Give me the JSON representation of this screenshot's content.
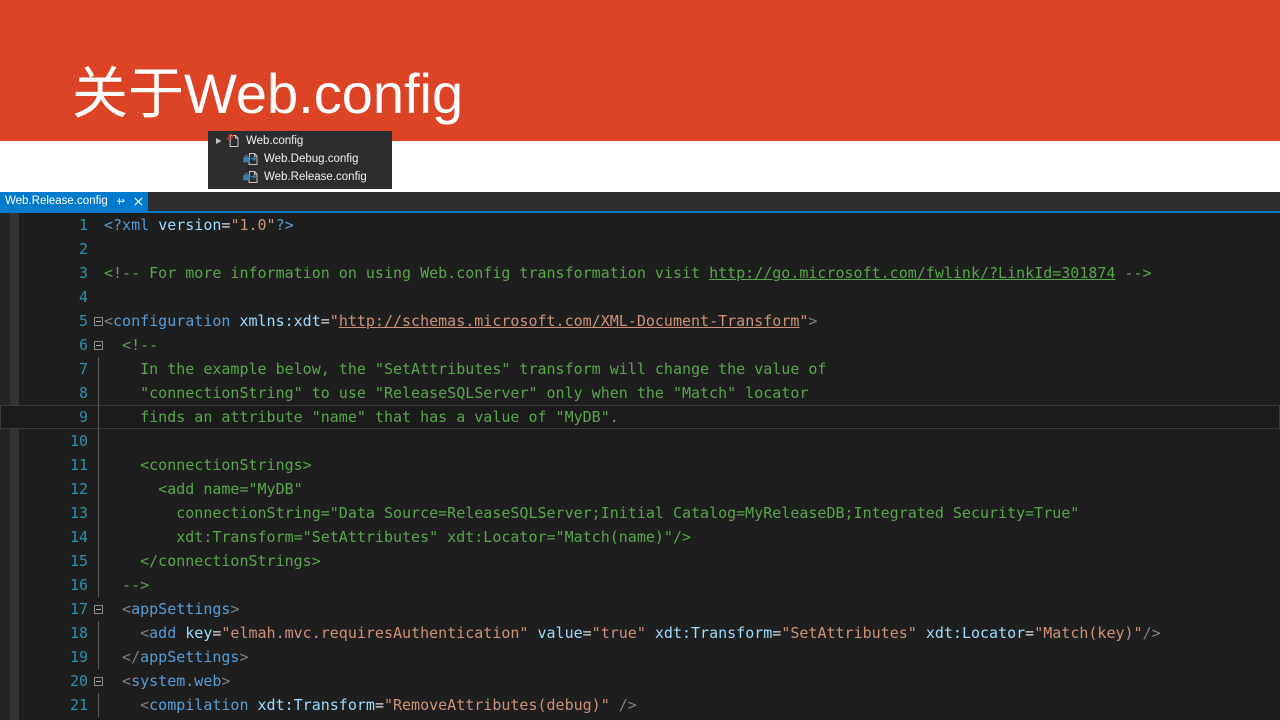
{
  "slide": {
    "title": "关于Web.config",
    "header_color": "#DC4425",
    "band_color": "#FFFFFF"
  },
  "solution_explorer": {
    "items": [
      {
        "label": "Web.config",
        "icon": "config-file-icon",
        "expander": "expander-collapsed-icon",
        "level": 0
      },
      {
        "label": "Web.Debug.config",
        "icon": "transform-file-icon",
        "expander": "",
        "level": 1
      },
      {
        "label": "Web.Release.config",
        "icon": "transform-file-icon",
        "expander": "",
        "level": 1
      }
    ]
  },
  "tabstrip": {
    "active_tab": "Web.Release.config",
    "pin_icon": "pin-icon",
    "close_icon": "close-icon",
    "accent_color": "#007ACC"
  },
  "editor": {
    "background": "#1E1E1E",
    "line_number_color": "#2B91AF",
    "current_line": 9,
    "lines": [
      {
        "n": "1",
        "fold": "",
        "foldline": false,
        "tokens": [
          {
            "c": "t-proc",
            "s": "<?xml"
          },
          {
            "c": "t-plain",
            "s": " "
          },
          {
            "c": "t-attr",
            "s": "version"
          },
          {
            "c": "t-plain",
            "s": "="
          },
          {
            "c": "t-str",
            "s": "\"1.0\""
          },
          {
            "c": "t-proc",
            "s": "?>"
          }
        ]
      },
      {
        "n": "2",
        "fold": "",
        "foldline": false,
        "tokens": []
      },
      {
        "n": "3",
        "fold": "",
        "foldline": false,
        "tokens": [
          {
            "c": "t-comment",
            "s": "<!-- For more information on using Web.config transformation visit "
          },
          {
            "c": "t-clink",
            "s": "http://go.microsoft.com/fwlink/?LinkId=301874"
          },
          {
            "c": "t-comment",
            "s": " -->"
          }
        ]
      },
      {
        "n": "4",
        "fold": "",
        "foldline": false,
        "tokens": []
      },
      {
        "n": "5",
        "fold": "box",
        "foldline": false,
        "tokens": [
          {
            "c": "t-punct",
            "s": "<"
          },
          {
            "c": "t-tag",
            "s": "configuration"
          },
          {
            "c": "t-plain",
            "s": " "
          },
          {
            "c": "t-attr",
            "s": "xmlns:xdt"
          },
          {
            "c": "t-plain",
            "s": "="
          },
          {
            "c": "t-str",
            "s": "\""
          },
          {
            "c": "t-link",
            "s": "http://schemas.microsoft.com/XML-Document-Transform"
          },
          {
            "c": "t-str",
            "s": "\""
          },
          {
            "c": "t-punct",
            "s": ">"
          }
        ]
      },
      {
        "n": "6",
        "fold": "box",
        "foldline": false,
        "tokens": [
          {
            "c": "t-comment",
            "s": "  <!--"
          }
        ]
      },
      {
        "n": "7",
        "fold": "",
        "foldline": true,
        "tokens": [
          {
            "c": "t-comment",
            "s": "    In the example below, the \"SetAttributes\" transform will change the value of"
          }
        ]
      },
      {
        "n": "8",
        "fold": "",
        "foldline": true,
        "tokens": [
          {
            "c": "t-comment",
            "s": "    \"connectionString\" to use \"ReleaseSQLServer\" only when the \"Match\" locator"
          }
        ]
      },
      {
        "n": "9",
        "fold": "",
        "foldline": true,
        "tokens": [
          {
            "c": "t-comment",
            "s": "    finds an attribute \"name\" that has a value of \"MyDB\"."
          }
        ]
      },
      {
        "n": "10",
        "fold": "",
        "foldline": true,
        "tokens": []
      },
      {
        "n": "11",
        "fold": "",
        "foldline": true,
        "tokens": [
          {
            "c": "t-comment",
            "s": "    <connectionStrings>"
          }
        ]
      },
      {
        "n": "12",
        "fold": "",
        "foldline": true,
        "tokens": [
          {
            "c": "t-comment",
            "s": "      <add name=\"MyDB\""
          }
        ]
      },
      {
        "n": "13",
        "fold": "",
        "foldline": true,
        "tokens": [
          {
            "c": "t-comment",
            "s": "        connectionString=\"Data Source=ReleaseSQLServer;Initial Catalog=MyReleaseDB;Integrated Security=True\""
          }
        ]
      },
      {
        "n": "14",
        "fold": "",
        "foldline": true,
        "tokens": [
          {
            "c": "t-comment",
            "s": "        xdt:Transform=\"SetAttributes\" xdt:Locator=\"Match(name)\"/>"
          }
        ]
      },
      {
        "n": "15",
        "fold": "",
        "foldline": true,
        "tokens": [
          {
            "c": "t-comment",
            "s": "    </connectionStrings>"
          }
        ]
      },
      {
        "n": "16",
        "fold": "",
        "foldline": true,
        "tokens": [
          {
            "c": "t-comment",
            "s": "  -->"
          }
        ]
      },
      {
        "n": "17",
        "fold": "box",
        "foldline": false,
        "tokens": [
          {
            "c": "t-punct",
            "s": "  <"
          },
          {
            "c": "t-tag",
            "s": "appSettings"
          },
          {
            "c": "t-punct",
            "s": ">"
          }
        ]
      },
      {
        "n": "18",
        "fold": "",
        "foldline": true,
        "tokens": [
          {
            "c": "t-punct",
            "s": "    <"
          },
          {
            "c": "t-tag",
            "s": "add"
          },
          {
            "c": "t-plain",
            "s": " "
          },
          {
            "c": "t-attr",
            "s": "key"
          },
          {
            "c": "t-plain",
            "s": "="
          },
          {
            "c": "t-str",
            "s": "\"elmah.mvc.requiresAuthentication\""
          },
          {
            "c": "t-plain",
            "s": " "
          },
          {
            "c": "t-attr",
            "s": "value"
          },
          {
            "c": "t-plain",
            "s": "="
          },
          {
            "c": "t-str",
            "s": "\"true\""
          },
          {
            "c": "t-plain",
            "s": " "
          },
          {
            "c": "t-attr",
            "s": "xdt:Transform"
          },
          {
            "c": "t-plain",
            "s": "="
          },
          {
            "c": "t-str",
            "s": "\"SetAttributes\""
          },
          {
            "c": "t-plain",
            "s": " "
          },
          {
            "c": "t-attr",
            "s": "xdt:Locator"
          },
          {
            "c": "t-plain",
            "s": "="
          },
          {
            "c": "t-str",
            "s": "\"Match(key)\""
          },
          {
            "c": "t-punct",
            "s": "/>"
          }
        ]
      },
      {
        "n": "19",
        "fold": "",
        "foldline": true,
        "tokens": [
          {
            "c": "t-punct",
            "s": "  </"
          },
          {
            "c": "t-tag",
            "s": "appSettings"
          },
          {
            "c": "t-punct",
            "s": ">"
          }
        ]
      },
      {
        "n": "20",
        "fold": "box",
        "foldline": false,
        "tokens": [
          {
            "c": "t-punct",
            "s": "  <"
          },
          {
            "c": "t-tag",
            "s": "system.web"
          },
          {
            "c": "t-punct",
            "s": ">"
          }
        ]
      },
      {
        "n": "21",
        "fold": "",
        "foldline": true,
        "tokens": [
          {
            "c": "t-punct",
            "s": "    <"
          },
          {
            "c": "t-tag",
            "s": "compilation"
          },
          {
            "c": "t-plain",
            "s": " "
          },
          {
            "c": "t-attr",
            "s": "xdt:Transform"
          },
          {
            "c": "t-plain",
            "s": "="
          },
          {
            "c": "t-str",
            "s": "\"RemoveAttributes(debug)\""
          },
          {
            "c": "t-plain",
            "s": " "
          },
          {
            "c": "t-punct",
            "s": "/>"
          }
        ]
      }
    ]
  }
}
